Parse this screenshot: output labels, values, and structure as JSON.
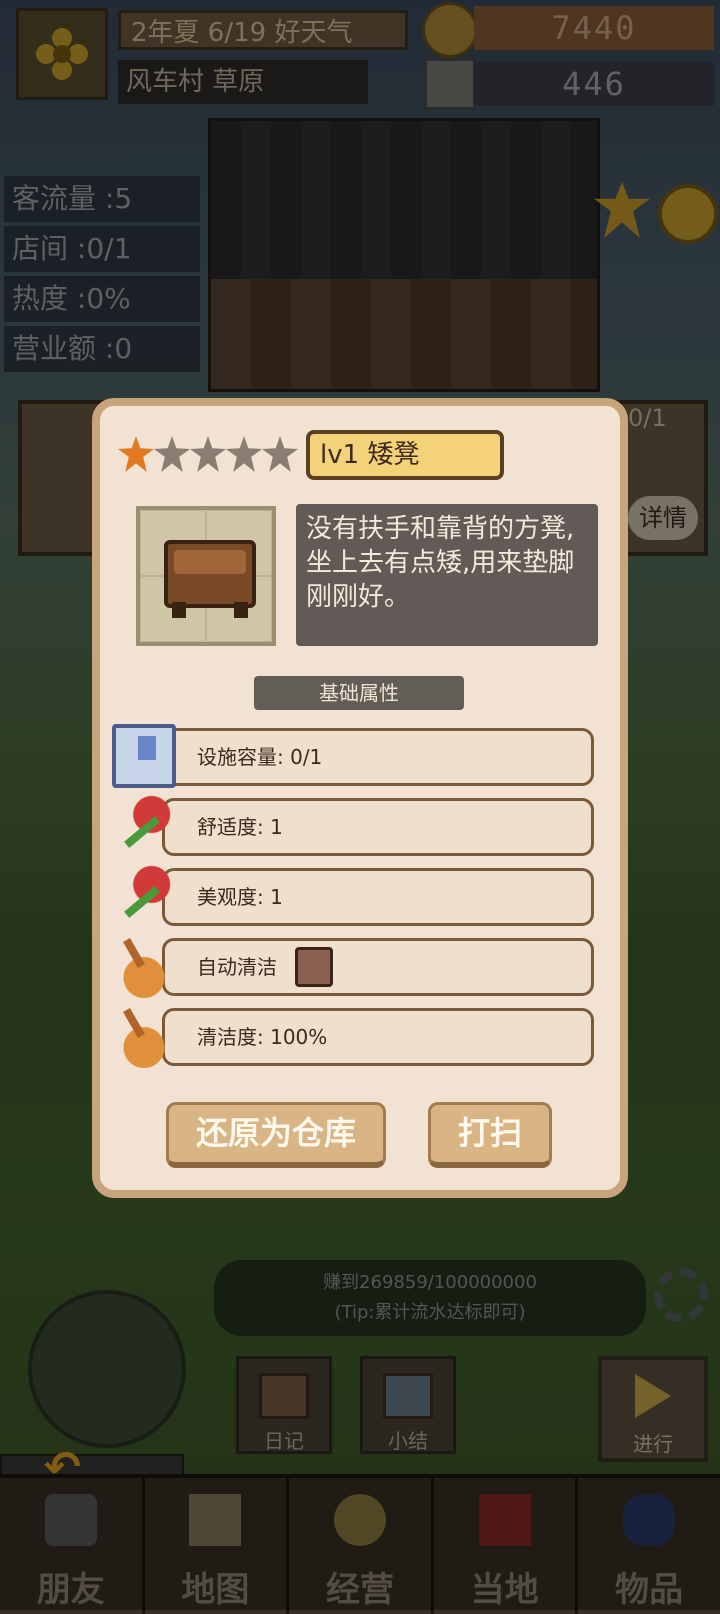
{
  "top": {
    "date": "2年夏 6/19 好天气",
    "location": "风车村 草原",
    "money": "7440",
    "gems": "446"
  },
  "stats": [
    "客流量 :5",
    "店间 :0/1",
    "热度 :0%",
    "营业额 :0"
  ],
  "background_card": {
    "count": "0/1",
    "detail_label": "详情"
  },
  "modal": {
    "stars_total": 5,
    "stars_filled": 1,
    "item_name": "lv1 矮凳",
    "description": "没有扶手和靠背的方凳,坐上去有点矮,用来垫脚刚刚好。",
    "section_title": "基础属性",
    "attributes": [
      {
        "icon": "storage-icon",
        "text": "设施容量: 0/1"
      },
      {
        "icon": "rose-icon",
        "text": "舒适度: 1"
      },
      {
        "icon": "rose-icon",
        "text": "美观度: 1"
      },
      {
        "icon": "broom-icon",
        "text": "自动清洁"
      },
      {
        "icon": "broom-icon",
        "text": "清洁度: 100%"
      }
    ],
    "auto_clean_checked": false,
    "buttons": {
      "restore": "还原为仓库",
      "sweep": "打扫"
    }
  },
  "tip": {
    "line1": "赚到269859/100000000",
    "line2": "(Tip:累计流水达标即可)"
  },
  "side_buttons": {
    "diary": "日记",
    "summary": "小结",
    "go": "进行"
  },
  "nav": [
    "朋友",
    "地图",
    "经营",
    "当地",
    "物品"
  ],
  "colors": {
    "modal_bg": "#f1e2d4",
    "modal_border": "#c7a47c",
    "name_box": "#f3d27a",
    "star_on": "#e27820",
    "button": "#d9b484"
  }
}
